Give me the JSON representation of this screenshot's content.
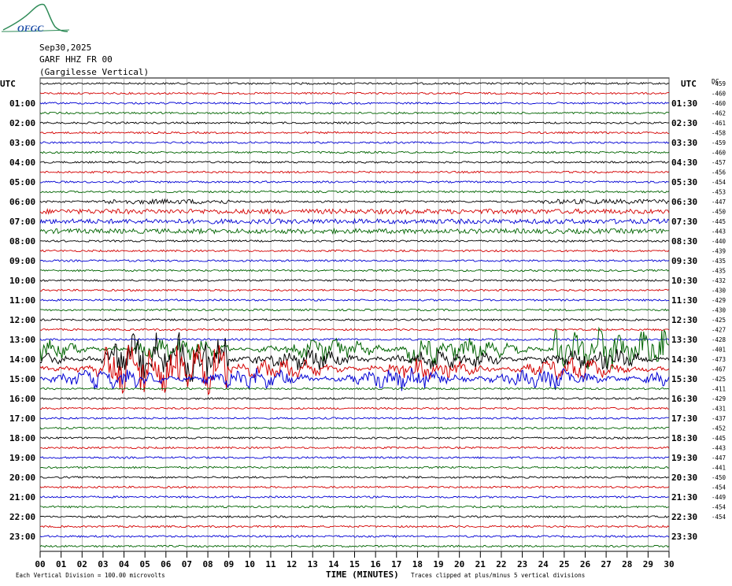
{
  "header": {
    "date": "Sep30,2025",
    "station": "GARF HHZ FR 00",
    "location": "(Gargilesse Vertical)",
    "logo_text": "OFGC"
  },
  "chart_data": {
    "type": "line",
    "subtype": "helicorder",
    "left_axis_label": "UTC",
    "right_axis_label": "UTC",
    "dc_label": "DC",
    "left_labels": [
      "01:00",
      "02:00",
      "03:00",
      "04:00",
      "05:00",
      "06:00",
      "07:00",
      "08:00",
      "09:00",
      "10:00",
      "11:00",
      "12:00",
      "13:00",
      "14:00",
      "15:00",
      "16:00",
      "17:00",
      "18:00",
      "19:00",
      "20:00",
      "21:00",
      "22:00",
      "23:00"
    ],
    "right_labels": [
      "01:30",
      "02:30",
      "03:30",
      "04:30",
      "05:30",
      "06:30",
      "07:30",
      "08:30",
      "09:30",
      "10:30",
      "11:30",
      "12:30",
      "13:30",
      "14:30",
      "15:30",
      "16:30",
      "17:30",
      "18:30",
      "19:30",
      "20:30",
      "21:30",
      "22:30",
      "23:30"
    ],
    "dc_offsets": [
      "-459",
      "-460",
      "-460",
      "-462",
      "-461",
      "-458",
      "-459",
      "-460",
      "-457",
      "-456",
      "-454",
      "-453",
      "-447",
      "-450",
      "-445",
      "-443",
      "-440",
      "-439",
      "-435",
      "-435",
      "-432",
      "-430",
      "-429",
      "-430",
      "-425",
      "-427",
      "-428",
      "-401",
      "-473",
      "-467",
      "-425",
      "-411",
      "-429",
      "-431",
      "-437",
      "-452",
      "-445",
      "-443",
      "-447",
      "-441",
      "-450",
      "-454",
      "-449",
      "-454",
      "-454"
    ],
    "x_ticks": [
      "00",
      "01",
      "02",
      "03",
      "04",
      "05",
      "06",
      "07",
      "08",
      "09",
      "10",
      "11",
      "12",
      "13",
      "14",
      "15",
      "16",
      "17",
      "18",
      "19",
      "20",
      "21",
      "22",
      "23",
      "24",
      "25",
      "26",
      "27",
      "28",
      "29",
      "30"
    ],
    "xlabel": "TIME (MINUTES)",
    "xlim": [
      0,
      30
    ],
    "row_colors": [
      "#000000",
      "#d40000",
      "#0000d4",
      "#006400"
    ],
    "footer_left": "Each Vertical Division =  100.00 microvolts",
    "footer_right": "Traces clipped at plus/minus 5 vertical divisions",
    "event_spans_minutes": [
      {
        "row": 13,
        "from": 0,
        "to": 30
      },
      {
        "row": 14,
        "from": 0,
        "to": 30
      },
      {
        "row": 15,
        "from": 0,
        "to": 30
      },
      {
        "row": 12,
        "from": 3,
        "to": 9
      },
      {
        "row": 12,
        "from": 24,
        "to": 30
      }
    ]
  }
}
